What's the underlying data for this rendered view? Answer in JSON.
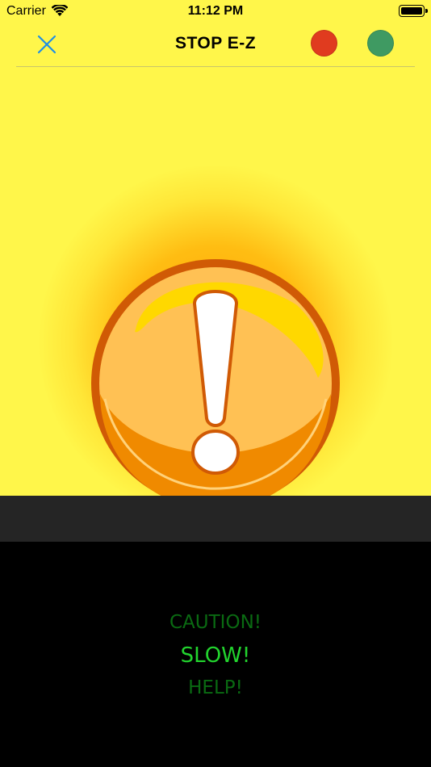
{
  "status_bar": {
    "carrier": "Carrier",
    "time": "11:12 PM"
  },
  "nav": {
    "title": "STOP E-Z",
    "close_icon": "close-x-icon",
    "colors": {
      "close": "#1e8ee6",
      "red_dot": "#e03b1f",
      "green_dot": "#3f9a62"
    }
  },
  "main": {
    "background_color": "#fff64a",
    "graphic_icon": "caution-exclamation-icon"
  },
  "modes": {
    "items": [
      "CAUTION!",
      "SLOW!",
      "HELP!"
    ],
    "selected": "SLOW!",
    "selected_color": "#22d42e",
    "unselected_color": "#0a6a12"
  }
}
